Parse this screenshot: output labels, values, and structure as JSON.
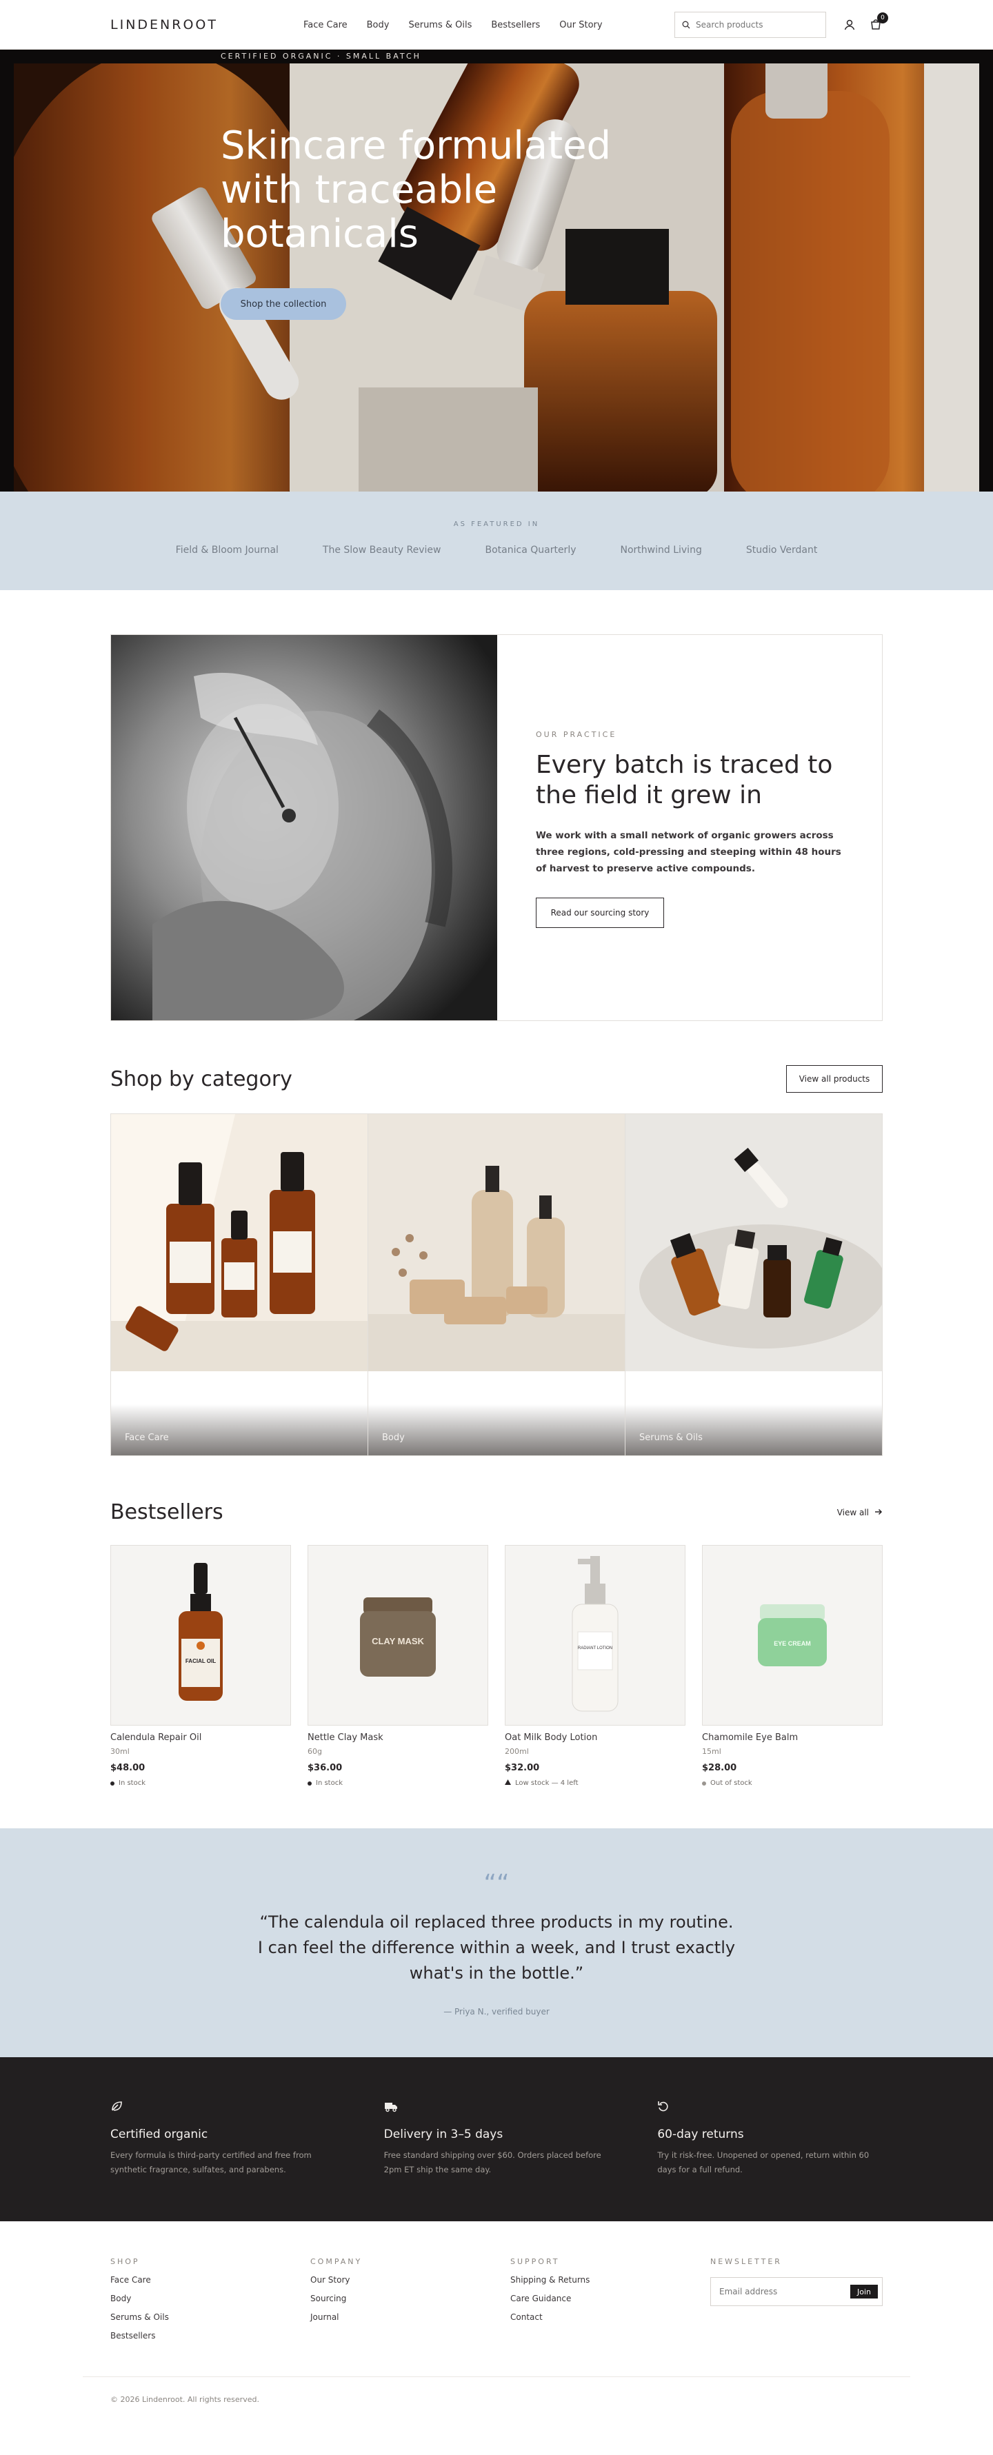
{
  "header": {
    "logo": "LINDENROOT",
    "nav": [
      "Face Care",
      "Body",
      "Serums & Oils",
      "Bestsellers",
      "Our Story"
    ],
    "search_placeholder": "Search products",
    "cart_count": "0"
  },
  "hero": {
    "eyebrow": "CERTIFIED ORGANIC · SMALL BATCH",
    "title": "Skincare formulated with traceable botanicals",
    "cta": "Shop the collection"
  },
  "featured": {
    "label": "AS FEATURED IN",
    "outlets": [
      "Field & Bloom Journal",
      "The Slow Beauty Review",
      "Botanica Quarterly",
      "Northwind Living",
      "Studio Verdant"
    ]
  },
  "story": {
    "kicker": "OUR PRACTICE",
    "title": "Every batch is traced to the field it grew in",
    "body": "We work with a small network of organic growers across three regions, cold-pressing and steeping within 48 hours of harvest to preserve active compounds.",
    "cta": "Read our sourcing story"
  },
  "categories": {
    "title": "Shop by category",
    "view_all": "View all products",
    "items": [
      "Face Care",
      "Body",
      "Serums & Oils"
    ]
  },
  "bestsellers": {
    "title": "Bestsellers",
    "view_all": "View all",
    "products": [
      {
        "name": "Calendula Repair Oil",
        "size": "30ml",
        "price": "$48.00",
        "stock": "In stock",
        "label": "FACIAL OIL"
      },
      {
        "name": "Nettle Clay Mask",
        "size": "60g",
        "price": "$36.00",
        "stock": "In stock",
        "label": "CLAY MASK"
      },
      {
        "name": "Oat Milk Body Lotion",
        "size": "200ml",
        "price": "$32.00",
        "stock": "Low stock — 4 left",
        "label": "RADIANT LOTION"
      },
      {
        "name": "Chamomile Eye Balm",
        "size": "15ml",
        "price": "$28.00",
        "stock": "Out of stock",
        "label": "EYE CREAM"
      }
    ]
  },
  "testimonial": {
    "quote": "“The calendula oil replaced three products in my routine. I can feel the difference within a week, and I trust exactly what's in the bottle.”",
    "author": "— Priya N., verified buyer"
  },
  "values": [
    {
      "title": "Certified organic",
      "body": "Every formula is third-party certified and free from synthetic fragrance, sulfates, and parabens.",
      "icon": "leaf-icon"
    },
    {
      "title": "Delivery in 3–5 days",
      "body": "Free standard shipping over $60. Orders placed before 2pm ET ship the same day.",
      "icon": "truck-icon"
    },
    {
      "title": "60-day returns",
      "body": "Try it risk-free. Unopened or opened, return within 60 days for a full refund.",
      "icon": "return-icon"
    }
  ],
  "footer": {
    "shop": {
      "title": "SHOP",
      "links": [
        "Face Care",
        "Body",
        "Serums & Oils",
        "Bestsellers"
      ]
    },
    "company": {
      "title": "COMPANY",
      "links": [
        "Our Story",
        "Sourcing",
        "Journal"
      ]
    },
    "support": {
      "title": "SUPPORT",
      "links": [
        "Shipping & Returns",
        "Care Guidance",
        "Contact"
      ]
    },
    "newsletter": {
      "title": "NEWSLETTER",
      "placeholder": "Email address",
      "button": "Join"
    },
    "copyright": "© 2026 Lindenroot. All rights reserved."
  },
  "colors": {
    "accent": "#a9c1de",
    "band": "#d3dde6",
    "dark": "#221f20",
    "in_stock": "#2a2628",
    "low_stock": "#2a2628",
    "out_of_stock": "#9a9590"
  }
}
